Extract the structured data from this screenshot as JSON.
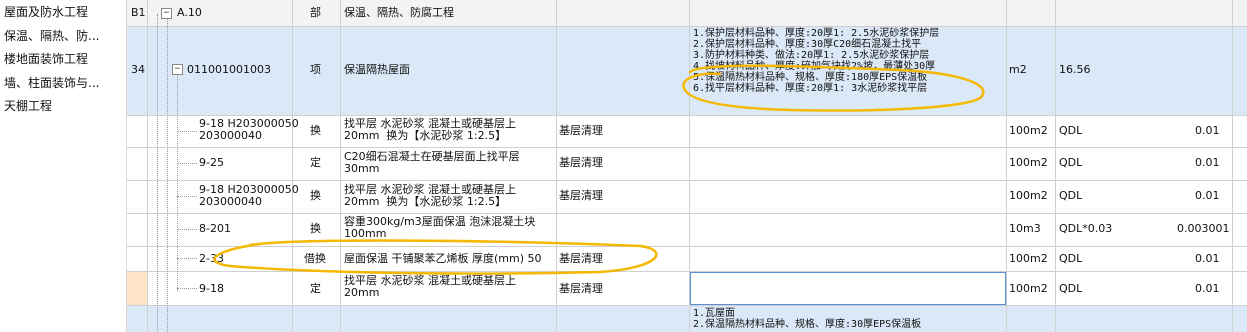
{
  "sidebar": {
    "items": [
      {
        "label": "屋面及防水工程"
      },
      {
        "label": "保温、隔热、防..."
      },
      {
        "label": "楼地面装饰工程"
      },
      {
        "label": "墙、柱面装饰与..."
      },
      {
        "label": "天棚工程"
      }
    ]
  },
  "rows": [
    {
      "seq": "B1",
      "code": "A.10",
      "type": "部",
      "name": "保温、隔热、防腐工程",
      "features": [],
      "work": "",
      "unit": "",
      "qty_expr": "",
      "qty": ""
    },
    {
      "seq": "34",
      "code": "011001001003",
      "type": "项",
      "name": "保温隔热屋面",
      "features": [
        "1.保护层材料品种、厚度:20厚1: 2.5水泥砂浆保护层",
        "2.保护层材料品种、厚度:30厚C20细石混凝土找平",
        "3.防护材料种类、做法:20厚1: 2.5水泥砂浆保护层",
        "4.找坡材料品种、厚度:碎加气块找2%坡，最薄处30厚",
        "5.保温隔热材料品种、规格、厚度:180厚EPS保温板",
        "6.找平层材料品种、厚度:20厚1: 3水泥砂浆找平层"
      ],
      "work": "",
      "unit": "m2",
      "qty_expr": "16.56",
      "qty": ""
    },
    {
      "seq": "",
      "code": "9-18 H203000050\n203000040",
      "type": "换",
      "name": "找平层 水泥砂浆 混凝土或硬基层上\n20mm  换为【水泥砂浆 1:2.5】",
      "features": [],
      "work": "基层清理",
      "unit": "100m2",
      "qty_expr": "QDL",
      "qty": "0.01"
    },
    {
      "seq": "",
      "code": "9-25",
      "type": "定",
      "name": "C20细石混凝土在硬基层面上找平层\n30mm",
      "features": [],
      "work": "基层清理",
      "unit": "100m2",
      "qty_expr": "QDL",
      "qty": "0.01"
    },
    {
      "seq": "",
      "code": "9-18 H203000050\n203000040",
      "type": "换",
      "name": "找平层 水泥砂浆 混凝土或硬基层上\n20mm  换为【水泥砂浆 1:2.5】",
      "features": [],
      "work": "基层清理",
      "unit": "100m2",
      "qty_expr": "QDL",
      "qty": "0.01"
    },
    {
      "seq": "",
      "code": "8-201",
      "type": "换",
      "name": "容重300kg/m3屋面保温 泡沫混凝土块\n100mm",
      "features": [],
      "work": "",
      "unit": "10m3",
      "qty_expr": "QDL*0.03",
      "qty": "0.003001"
    },
    {
      "seq": "",
      "code": "2-33",
      "type": "借换",
      "name": "屋面保温 干铺聚苯乙烯板 厚度(mm) 50",
      "features": [],
      "work": "基层清理",
      "unit": "100m2",
      "qty_expr": "QDL",
      "qty": "0.01"
    },
    {
      "seq": "",
      "code": "9-18",
      "type": "定",
      "name": "找平层 水泥砂浆 混凝土或硬基层上\n20mm",
      "features": [],
      "work": "基层清理",
      "unit": "100m2",
      "qty_expr": "QDL",
      "qty": "0.01"
    },
    {
      "seq": "",
      "code": "",
      "type": "",
      "name": "",
      "features": [
        "1.瓦屋面",
        "2.保温隔热材料品种、规格、厚度:30厚EPS保温板"
      ],
      "work": "",
      "unit": "",
      "qty_expr": "",
      "qty": ""
    }
  ],
  "colors": {
    "selected_row": "#dbe8f7",
    "annotation": "#f5b800",
    "edit_border": "#5a8fd6"
  },
  "icons": {
    "collapse": "minus-box-icon"
  }
}
